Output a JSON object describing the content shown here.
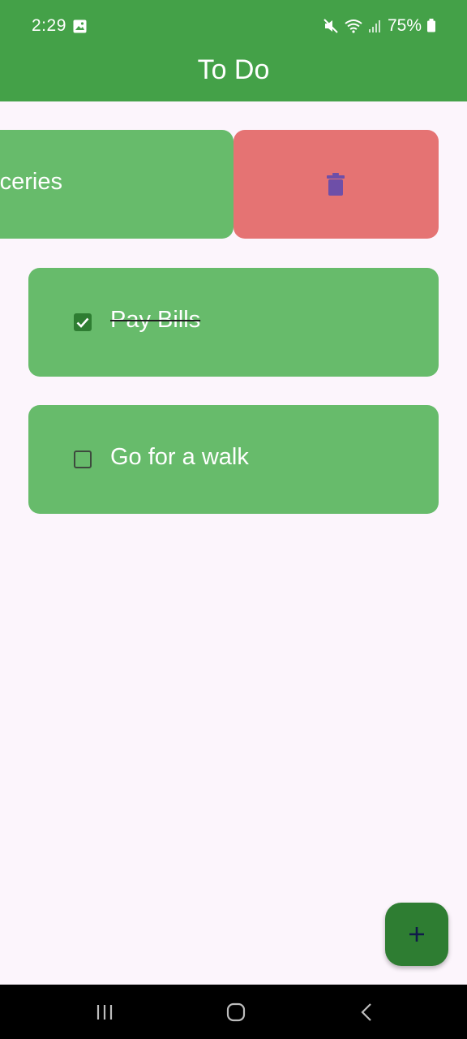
{
  "status_bar": {
    "time": "2:29",
    "battery": "75%",
    "icons": [
      "gallery-icon",
      "mute-icon",
      "wifi-icon",
      "signal-icon",
      "battery-icon"
    ]
  },
  "app_bar": {
    "title": "To Do",
    "color": "#44a148"
  },
  "todos": [
    {
      "label": "Buy Groceries",
      "visible_text": "ceries",
      "done": false,
      "state": "swiped-to-delete"
    },
    {
      "label": "Pay Bills",
      "done": true
    },
    {
      "label": "Go for a walk",
      "done": false
    }
  ],
  "delete_action": {
    "icon": "trash-icon",
    "color": "#e57373"
  },
  "fab": {
    "icon": "plus-icon",
    "color": "#2e7d32"
  },
  "nav_bar": {
    "buttons": [
      "recents-icon",
      "home-icon",
      "back-icon"
    ]
  }
}
